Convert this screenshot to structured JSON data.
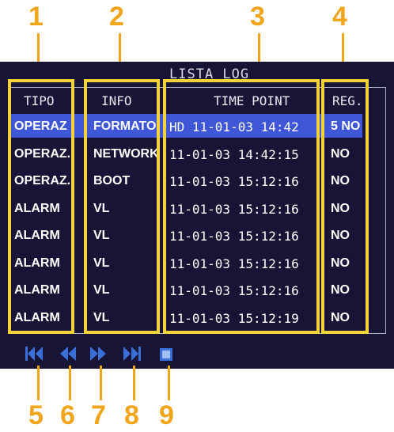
{
  "callouts": {
    "top": [
      "1",
      "2",
      "3",
      "4"
    ],
    "bottom": [
      "5",
      "6",
      "7",
      "8",
      "9"
    ]
  },
  "screen": {
    "title": "LISTA LOG",
    "columns": {
      "tipo": "TIPO",
      "info": "INFO",
      "time_point": "TIME POINT",
      "reg": "REG."
    },
    "rows": [
      {
        "tipo": "OPERAZ",
        "info": "FORMATO",
        "time": "HD 11-01-03 14:42",
        "reg": "5 NO"
      },
      {
        "tipo": "OPERAZ.",
        "info": "NETWORK",
        "time": "11-01-03 14:42:15",
        "reg": "NO"
      },
      {
        "tipo": "OPERAZ.",
        "info": "BOOT",
        "time": "11-01-03 15:12:16",
        "reg": "NO"
      },
      {
        "tipo": "ALARM",
        "info": "VL",
        "time": "11-01-03 15:12:16",
        "reg": "NO"
      },
      {
        "tipo": "ALARM",
        "info": "VL",
        "time": "11-01-03 15:12:16",
        "reg": "NO"
      },
      {
        "tipo": "ALARM",
        "info": "VL",
        "time": "11-01-03 15:12:16",
        "reg": "NO"
      },
      {
        "tipo": "ALARM",
        "info": "VL",
        "time": "11-01-03 15:12:16",
        "reg": "NO"
      },
      {
        "tipo": "ALARM",
        "info": "VL",
        "time": "11-01-03 15:12:19",
        "reg": "NO"
      }
    ],
    "selected_row": 0,
    "controls": [
      "first-page-icon",
      "previous-page-icon",
      "next-page-icon",
      "last-page-icon",
      "stop-icon"
    ]
  },
  "colors": {
    "callout": "#f0a51b",
    "highlight_box": "#f4d23a",
    "screen_bg": "#181436",
    "selected_row": "#3f57d7",
    "control_icon": "#3b6fd8"
  }
}
